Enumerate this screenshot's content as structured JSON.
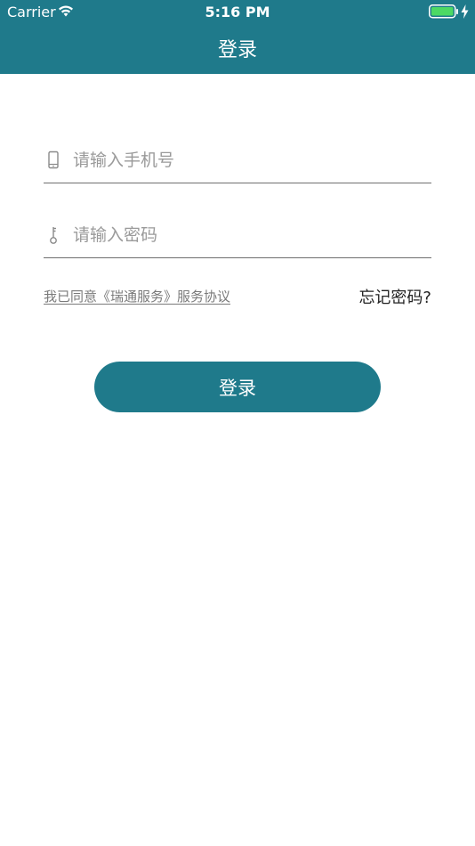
{
  "status_bar": {
    "carrier": "Carrier",
    "time": "5:16 PM",
    "icons": [
      "wifi-icon",
      "battery-icon",
      "charging-icon"
    ]
  },
  "nav": {
    "title": "登录"
  },
  "form": {
    "phone": {
      "placeholder": "请输入手机号",
      "value": "",
      "icon": "phone-icon"
    },
    "password": {
      "placeholder": "请输入密码",
      "value": "",
      "icon": "key-icon"
    },
    "agreement_text": "我已同意《瑞通服务》服务协议",
    "forgot_password": "忘记密码?",
    "login_button": "登录"
  },
  "colors": {
    "primary": "#1f7a8b",
    "divider": "#6f6f6f",
    "placeholder": "#9a9a9a",
    "battery": "#4cd964"
  }
}
